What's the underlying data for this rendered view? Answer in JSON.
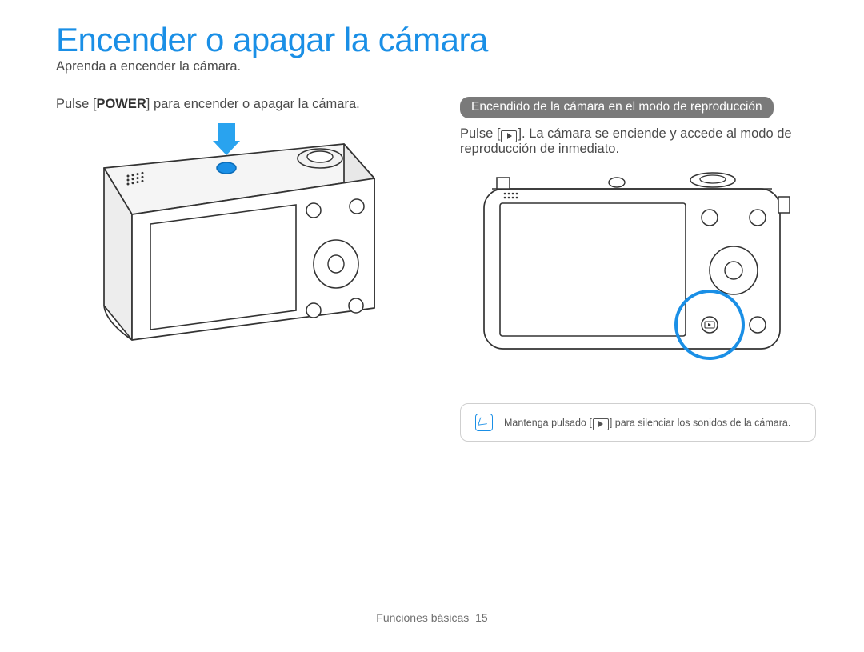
{
  "title": "Encender o apagar la cámara",
  "subtitle": "Aprenda a encender la cámara.",
  "left": {
    "instruction_prefix": "Pulse [",
    "power_label": "POWER",
    "instruction_suffix": "] para encender o apagar la cámara."
  },
  "right": {
    "pill": "Encendido de la cámara en el modo de reproducción",
    "instruction_prefix": "Pulse [",
    "instruction_suffix": "]. La cámara se enciende y accede al modo de reproducción de inmediato."
  },
  "note": {
    "text_prefix": "Mantenga pulsado [",
    "text_suffix": "] para silenciar los sonidos de la cámara."
  },
  "footer": {
    "section": "Funciones básicas",
    "page_num": "15"
  }
}
